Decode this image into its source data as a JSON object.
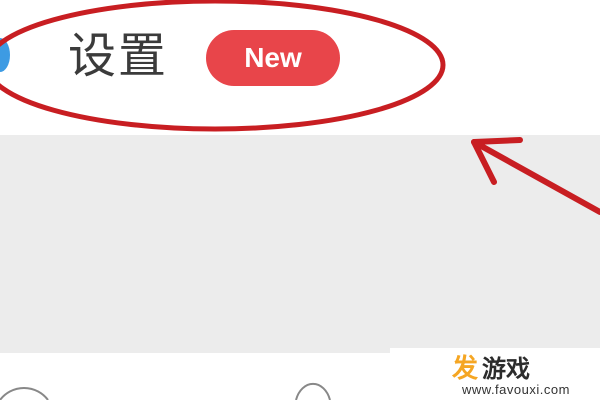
{
  "header": {
    "title": "设置",
    "badge": "New",
    "gear_icon": "gear-icon"
  },
  "watermark": {
    "logo_char": "发",
    "brand": "游戏",
    "url": "www.favouxi.com"
  },
  "colors": {
    "badge_bg": "#e8454a",
    "annotation_red": "#c81e22",
    "gear_blue": "#3d9be3",
    "content_bg": "#ececec"
  }
}
